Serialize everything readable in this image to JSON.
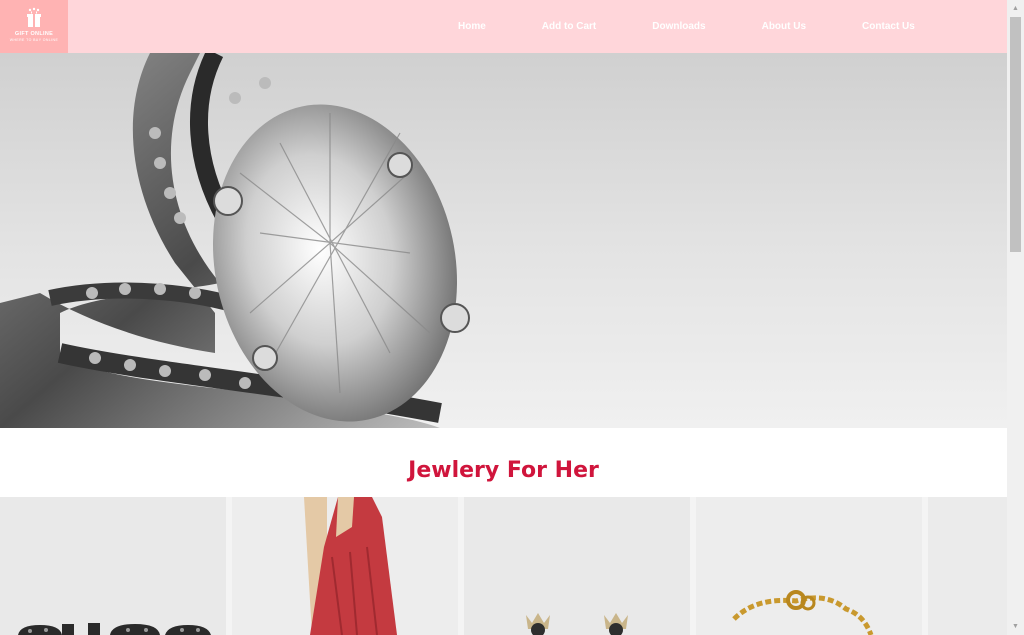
{
  "header": {
    "logo": {
      "name": "GIFT ONLINE",
      "tagline": "WHERE TO BUY ONLINE"
    },
    "nav": [
      {
        "label": "Home"
      },
      {
        "label": "Add to Cart"
      },
      {
        "label": "Downloads"
      },
      {
        "label": "About Us"
      },
      {
        "label": "Contact Us"
      }
    ]
  },
  "hero": {
    "image": "diamond-ring-photo"
  },
  "section": {
    "title": "Jewlery For Her"
  },
  "products": [
    {
      "image": "black-ring-photo"
    },
    {
      "image": "red-dress-photo"
    },
    {
      "image": "crystal-earrings-photo"
    },
    {
      "image": "gold-bracelet-photo"
    },
    {
      "image": "partial-product-photo"
    }
  ],
  "colors": {
    "header_bg": "#ffd6da",
    "logo_bg": "#ffb3b3",
    "title": "#d0153c"
  }
}
